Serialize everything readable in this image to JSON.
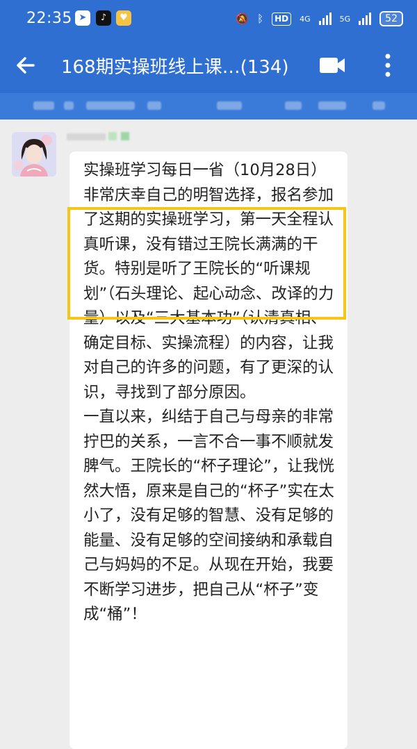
{
  "status_bar": {
    "time": "22:35",
    "hd_label": "HD",
    "net_4g": "4G",
    "net_5g": "5G",
    "battery": "52"
  },
  "header": {
    "title": "168期实操班线上课…(134)"
  },
  "message": {
    "text": "实操班学习每日一省（10月28日）\n非常庆幸自己的明智选择，报名参加了这期的实操班学习，第一天全程认真听课，没有错过王院长满满的干货。特别是听了王院长的“听课规划”（石头理论、起心动念、改译的力量）以及“三大基本功”（认清真相、确定目标、实操流程）的内容，让我对自己的许多的问题，有了更深的认识，寻找到了部分原因。\n一直以来，纠结于自己与母亲的非常拧巴的关系，一言不合一事不顺就发脾气。王院长的“杯子理论”，让我恍然大悟，原来是自己的“杯子”实在太小了，没有足够的智慧、没有足够的能量、没有足够的空间接纳和承载自己与妈妈的不足。从现在开始，我要不断学习进步，把自己从“杯子”变成“桶”！"
  },
  "colors": {
    "header_bg": "#2f6fd1",
    "highlight_border": "#f5c518",
    "chat_bg": "#ededed",
    "bubble_bg": "#ffffff"
  }
}
